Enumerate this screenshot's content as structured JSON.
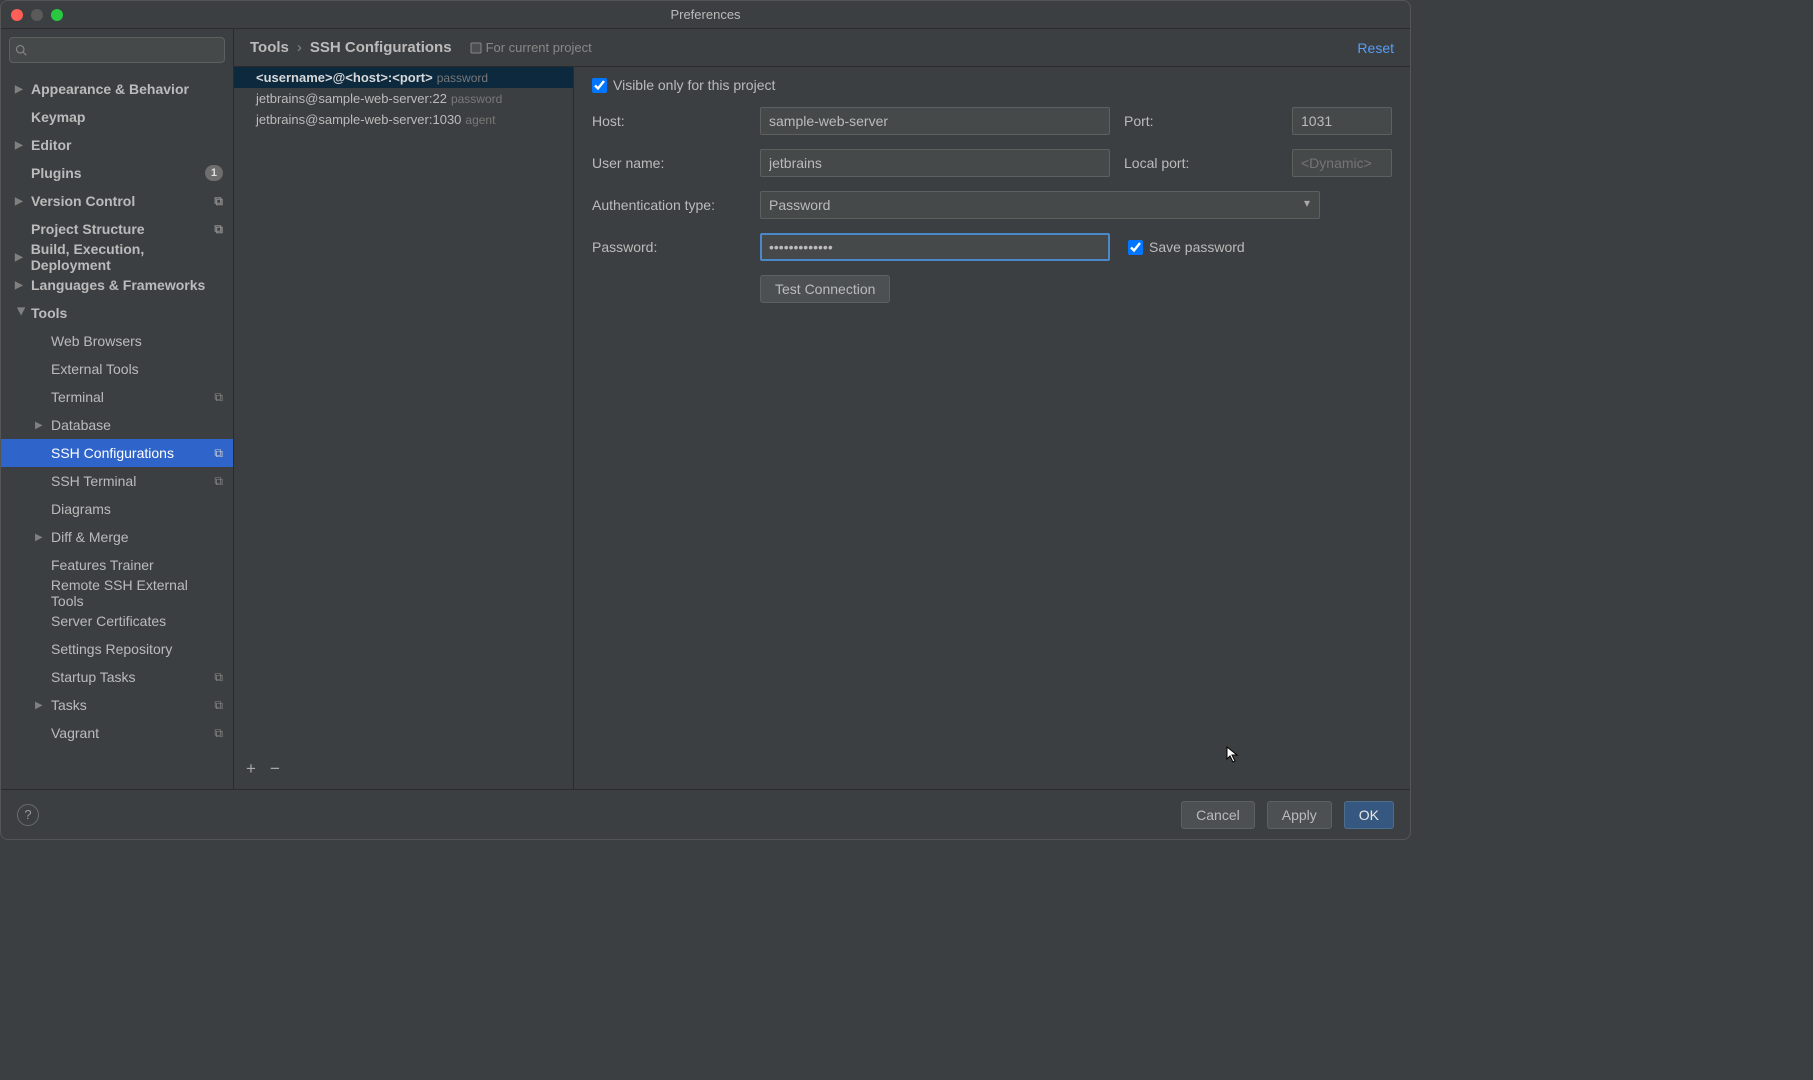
{
  "window": {
    "title": "Preferences"
  },
  "sidebar": {
    "search_placeholder": "",
    "items": [
      {
        "label": "Appearance & Behavior",
        "bold": true,
        "arrow": "closed",
        "indent": 0
      },
      {
        "label": "Keymap",
        "bold": true,
        "indent": 0
      },
      {
        "label": "Editor",
        "bold": true,
        "arrow": "closed",
        "indent": 0
      },
      {
        "label": "Plugins",
        "bold": true,
        "indent": 0,
        "badge": "1"
      },
      {
        "label": "Version Control",
        "bold": true,
        "arrow": "closed",
        "indent": 0,
        "scope": true
      },
      {
        "label": "Project Structure",
        "bold": true,
        "indent": 0,
        "scope": true
      },
      {
        "label": "Build, Execution, Deployment",
        "bold": true,
        "arrow": "closed",
        "indent": 0
      },
      {
        "label": "Languages & Frameworks",
        "bold": true,
        "arrow": "closed",
        "indent": 0
      },
      {
        "label": "Tools",
        "bold": true,
        "arrow": "open",
        "indent": 0
      },
      {
        "label": "Web Browsers",
        "indent": 1
      },
      {
        "label": "External Tools",
        "indent": 1
      },
      {
        "label": "Terminal",
        "indent": 1,
        "scope": true
      },
      {
        "label": "Database",
        "indent": 1,
        "arrow": "closed"
      },
      {
        "label": "SSH Configurations",
        "indent": 1,
        "selected": true,
        "scope": true
      },
      {
        "label": "SSH Terminal",
        "indent": 1,
        "scope": true
      },
      {
        "label": "Diagrams",
        "indent": 1
      },
      {
        "label": "Diff & Merge",
        "indent": 1,
        "arrow": "closed"
      },
      {
        "label": "Features Trainer",
        "indent": 1
      },
      {
        "label": "Remote SSH External Tools",
        "indent": 1
      },
      {
        "label": "Server Certificates",
        "indent": 1
      },
      {
        "label": "Settings Repository",
        "indent": 1
      },
      {
        "label": "Startup Tasks",
        "indent": 1,
        "scope": true
      },
      {
        "label": "Tasks",
        "indent": 1,
        "arrow": "closed",
        "scope": true
      },
      {
        "label": "Vagrant",
        "indent": 1,
        "scope": true
      }
    ]
  },
  "header": {
    "crumb1": "Tools",
    "crumb2": "SSH Configurations",
    "for_project": "For current project",
    "reset": "Reset"
  },
  "config_list": [
    {
      "main": "<username>@<host>:<port>",
      "auth": "password",
      "selected": true
    },
    {
      "main": "jetbrains@sample-web-server:22",
      "auth": "password"
    },
    {
      "main": "jetbrains@sample-web-server:1030",
      "auth": "agent"
    }
  ],
  "toolbar": {
    "add": "+",
    "remove": "−"
  },
  "form": {
    "visible_only_label": "Visible only for this project",
    "visible_only_checked": true,
    "host_label": "Host:",
    "host_value": "sample-web-server",
    "port_label": "Port:",
    "port_value": "1031",
    "user_label": "User name:",
    "user_value": "jetbrains",
    "localport_label": "Local port:",
    "localport_placeholder": "<Dynamic>",
    "auth_label": "Authentication type:",
    "auth_value": "Password",
    "password_label": "Password:",
    "password_value": "•••••••••••••",
    "save_password_label": "Save password",
    "save_password_checked": true,
    "test_btn": "Test Connection"
  },
  "footer": {
    "cancel": "Cancel",
    "apply": "Apply",
    "ok": "OK"
  }
}
